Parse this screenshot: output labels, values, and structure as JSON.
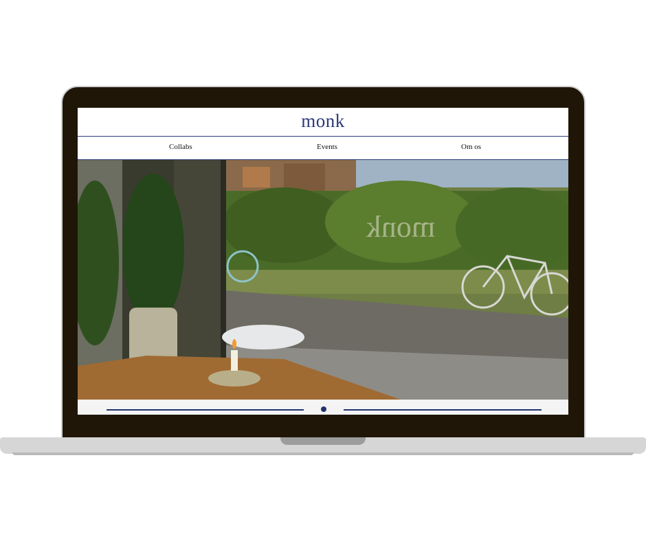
{
  "site": {
    "logo": "monk",
    "nav": [
      "Collabs",
      "Events",
      "Om os"
    ],
    "hero_window_lettering": "monk"
  },
  "slider": {
    "slide_count": 1,
    "active_index": 0
  },
  "colors": {
    "brand": "#2b3a7a",
    "laptop_bezel": "#1f1608",
    "laptop_base": "#d6d6d6"
  }
}
